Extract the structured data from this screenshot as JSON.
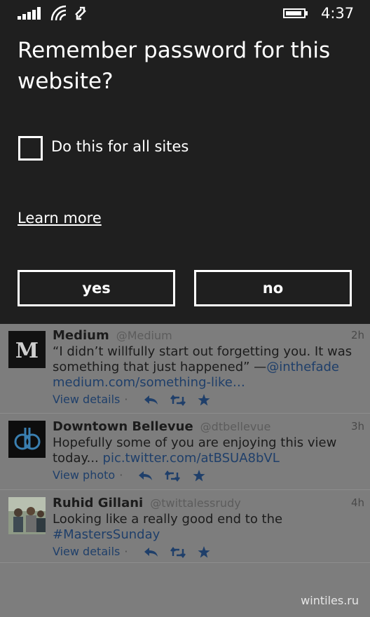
{
  "status_bar": {
    "time": "4:37",
    "icons": [
      "signal-icon",
      "wifi-icon",
      "data-sync-icon",
      "battery-icon"
    ]
  },
  "dialog": {
    "title": "Remember password for this website?",
    "checkbox_label": "Do this for all sites",
    "checkbox_checked": false,
    "learn_more": "Learn more",
    "yes_label": "yes",
    "no_label": "no"
  },
  "tweets": [
    {
      "author": "Medium",
      "handle": "@Medium",
      "age": "2h",
      "text": "“I didn’t willfully start out forgetting you. It was something that just happened” —",
      "mention": "@inthefade",
      "link": "medium.com/something-like…",
      "action_label": "View details",
      "avatar": "medium-logo"
    },
    {
      "author": "Downtown Bellevue",
      "handle": "@dtbellevue",
      "age": "3h",
      "text": "Hopefully some of you are enjoying this view today...",
      "link": "pic.twitter.com/atBSUA8bVL",
      "action_label": "View photo",
      "avatar": "db-logo"
    },
    {
      "author": "Ruhid Gillani",
      "handle": "@twittalessrudy",
      "age": "4h",
      "text": "Looking like a really good end to the",
      "link": "#MastersSunday",
      "action_label": "View details",
      "avatar": "people-photo"
    }
  ],
  "watermark": "wintiles.ru",
  "colors": {
    "dialog_bg": "#1f1f1f",
    "dimmed_feed_bg": "#7d7d7d",
    "link": "#1f3f6a"
  }
}
